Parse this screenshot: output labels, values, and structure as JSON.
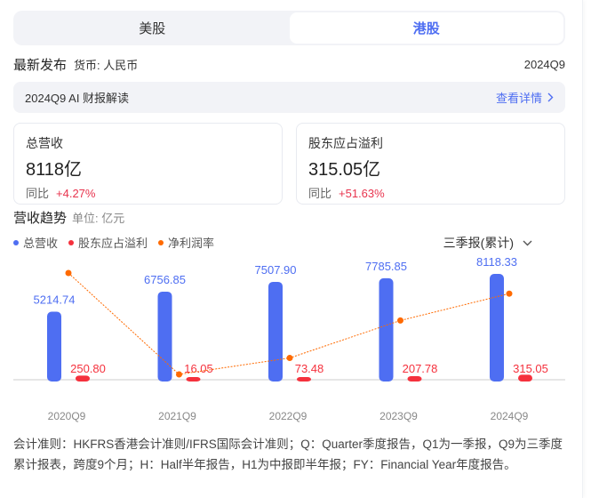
{
  "tabs": [
    {
      "label": "美股",
      "active": false
    },
    {
      "label": "港股",
      "active": true
    }
  ],
  "latest": {
    "title": "最新发布",
    "currency": "货币: 人民币",
    "period": "2024Q9"
  },
  "ai": {
    "label": "2024Q9 AI 财报解读",
    "more": "查看详情"
  },
  "cards": [
    {
      "label": "总营收",
      "value": "8118亿",
      "yoy_label": "同比",
      "yoy": "+4.27%"
    },
    {
      "label": "股东应占溢利",
      "value": "315.05亿",
      "yoy_label": "同比",
      "yoy": "+51.63%"
    }
  ],
  "trend": {
    "title": "营收趋势",
    "unit": "单位: 亿元",
    "selector": "三季报(累计)"
  },
  "colors": {
    "revenue": "#4e6ef2",
    "profit": "#f5313d",
    "margin": "#ff6a00",
    "accent": "#4e6ef2"
  },
  "chart_data": {
    "type": "bar",
    "categories": [
      "2020Q9",
      "2021Q9",
      "2022Q9",
      "2023Q9",
      "2024Q9"
    ],
    "series": [
      {
        "name": "总营收",
        "type": "bar",
        "values": [
          5214.74,
          6756.85,
          7507.9,
          7785.85,
          8118.33
        ],
        "labels": [
          "5214.74",
          "6756.85",
          "7507.90",
          "7785.85",
          "8118.33"
        ]
      },
      {
        "name": "股东应占溢利",
        "type": "bar",
        "values": [
          250.8,
          16.05,
          73.48,
          207.78,
          315.05
        ],
        "labels": [
          "250.80",
          "16.05",
          "73.48",
          "207.78",
          "315.05"
        ]
      },
      {
        "name": "净利润率",
        "type": "line",
        "values": [
          4.81,
          0.24,
          0.98,
          2.67,
          3.88
        ]
      }
    ],
    "legend": "top-left",
    "grid": false
  },
  "note": "会计准则：HKFRS香港会计准则/IFRS国际会计准则；Q：Quarter季度报告，Q1为一季报，Q9为三季度累计报表，跨度9个月；H：Half半年报告，H1为中报即半年报；FY：Financial Year年度报告。"
}
